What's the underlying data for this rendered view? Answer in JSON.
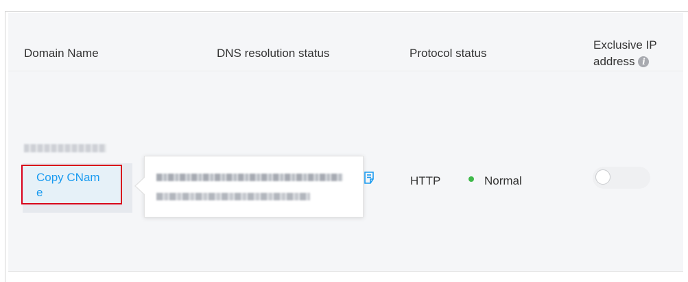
{
  "table": {
    "headers": {
      "domain_name": "Domain Name",
      "dns_resolution_status": "DNS resolution status",
      "protocol_status": "Protocol status",
      "exclusive_ip_line1": "Exclusive IP",
      "exclusive_ip_line2": "address"
    },
    "rows": [
      {
        "copy_cname_label": "Copy CName",
        "copy_cname_line1": "Copy CNam",
        "copy_cname_line2": "e",
        "protocol": "HTTP",
        "status": "Normal",
        "exclusive_ip_enabled": false
      }
    ]
  },
  "icons": {
    "header_info": "info-icon",
    "cname_details": "document-icon"
  },
  "colors": {
    "link_blue": "#1a9bf0",
    "highlight_red": "#d9001b",
    "status_green": "#3fb94a",
    "row_background": "#f5f6f8"
  }
}
